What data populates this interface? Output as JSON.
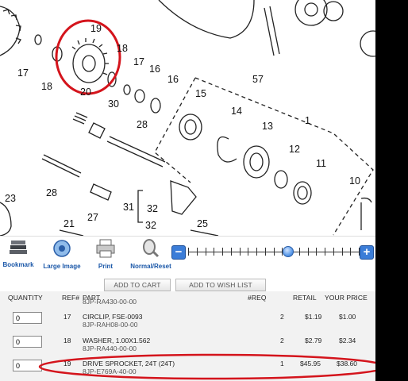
{
  "diagram": {
    "callouts": [
      {
        "id": "c17a",
        "label": "17"
      },
      {
        "id": "c18a",
        "label": "18"
      },
      {
        "id": "c19",
        "label": "19"
      },
      {
        "id": "c18b",
        "label": "18"
      },
      {
        "id": "c17b",
        "label": "17"
      },
      {
        "id": "c16a",
        "label": "16"
      },
      {
        "id": "c16b",
        "label": "16"
      },
      {
        "id": "c57",
        "label": "57"
      },
      {
        "id": "c20",
        "label": "20"
      },
      {
        "id": "c30",
        "label": "30"
      },
      {
        "id": "c15",
        "label": "15"
      },
      {
        "id": "c14",
        "label": "14"
      },
      {
        "id": "c28a",
        "label": "28"
      },
      {
        "id": "c13",
        "label": "13"
      },
      {
        "id": "c1",
        "label": "1"
      },
      {
        "id": "c12",
        "label": "12"
      },
      {
        "id": "c11",
        "label": "11"
      },
      {
        "id": "c10",
        "label": "10"
      },
      {
        "id": "c23",
        "label": "23"
      },
      {
        "id": "c28b",
        "label": "28"
      },
      {
        "id": "c27",
        "label": "27"
      },
      {
        "id": "c31",
        "label": "31"
      },
      {
        "id": "c32a",
        "label": "32"
      },
      {
        "id": "c32b",
        "label": "32"
      },
      {
        "id": "c21",
        "label": "21"
      },
      {
        "id": "c25",
        "label": "25"
      }
    ]
  },
  "toolbar": {
    "bookmark_label": "Bookmark",
    "large_image_label": "Large Image",
    "print_label": "Print",
    "normal_reset_label": "Normal/Reset",
    "zoom_minus": "−",
    "zoom_plus": "+",
    "zoom_level": 0.58
  },
  "actions": {
    "add_to_cart": "ADD TO CART",
    "add_to_wish_list": "ADD TO WISH LIST"
  },
  "table": {
    "headers": {
      "quantity": "QUANTITY",
      "ref": "REF#",
      "part": "PART",
      "req": "#REQ",
      "retail": "RETAIL",
      "your_price": "YOUR PRICE"
    },
    "partial_row_part_no": "8JP-RA430-00-00",
    "rows": [
      {
        "qty": "0",
        "ref": "17",
        "name": "CIRCLIP, FSE-0093",
        "part_no": "8JP-RAH08-00-00",
        "req": "2",
        "retail": "$1.19",
        "your_price": "$1.00"
      },
      {
        "qty": "0",
        "ref": "18",
        "name": "WASHER, 1.00X1.562",
        "part_no": "8JP-RA440-00-00",
        "req": "2",
        "retail": "$2.79",
        "your_price": "$2.34"
      },
      {
        "qty": "0",
        "ref": "19",
        "name": "DRIVE SPROCKET, 24T  (24T)",
        "part_no": "8JP-E769A-40-00",
        "req": "1",
        "retail": "$45.95",
        "your_price": "$38.60"
      }
    ]
  },
  "colors": {
    "highlight_red": "#d4141c",
    "link_blue": "#1a57a8",
    "zoom_blue": "#3b7dd8"
  }
}
